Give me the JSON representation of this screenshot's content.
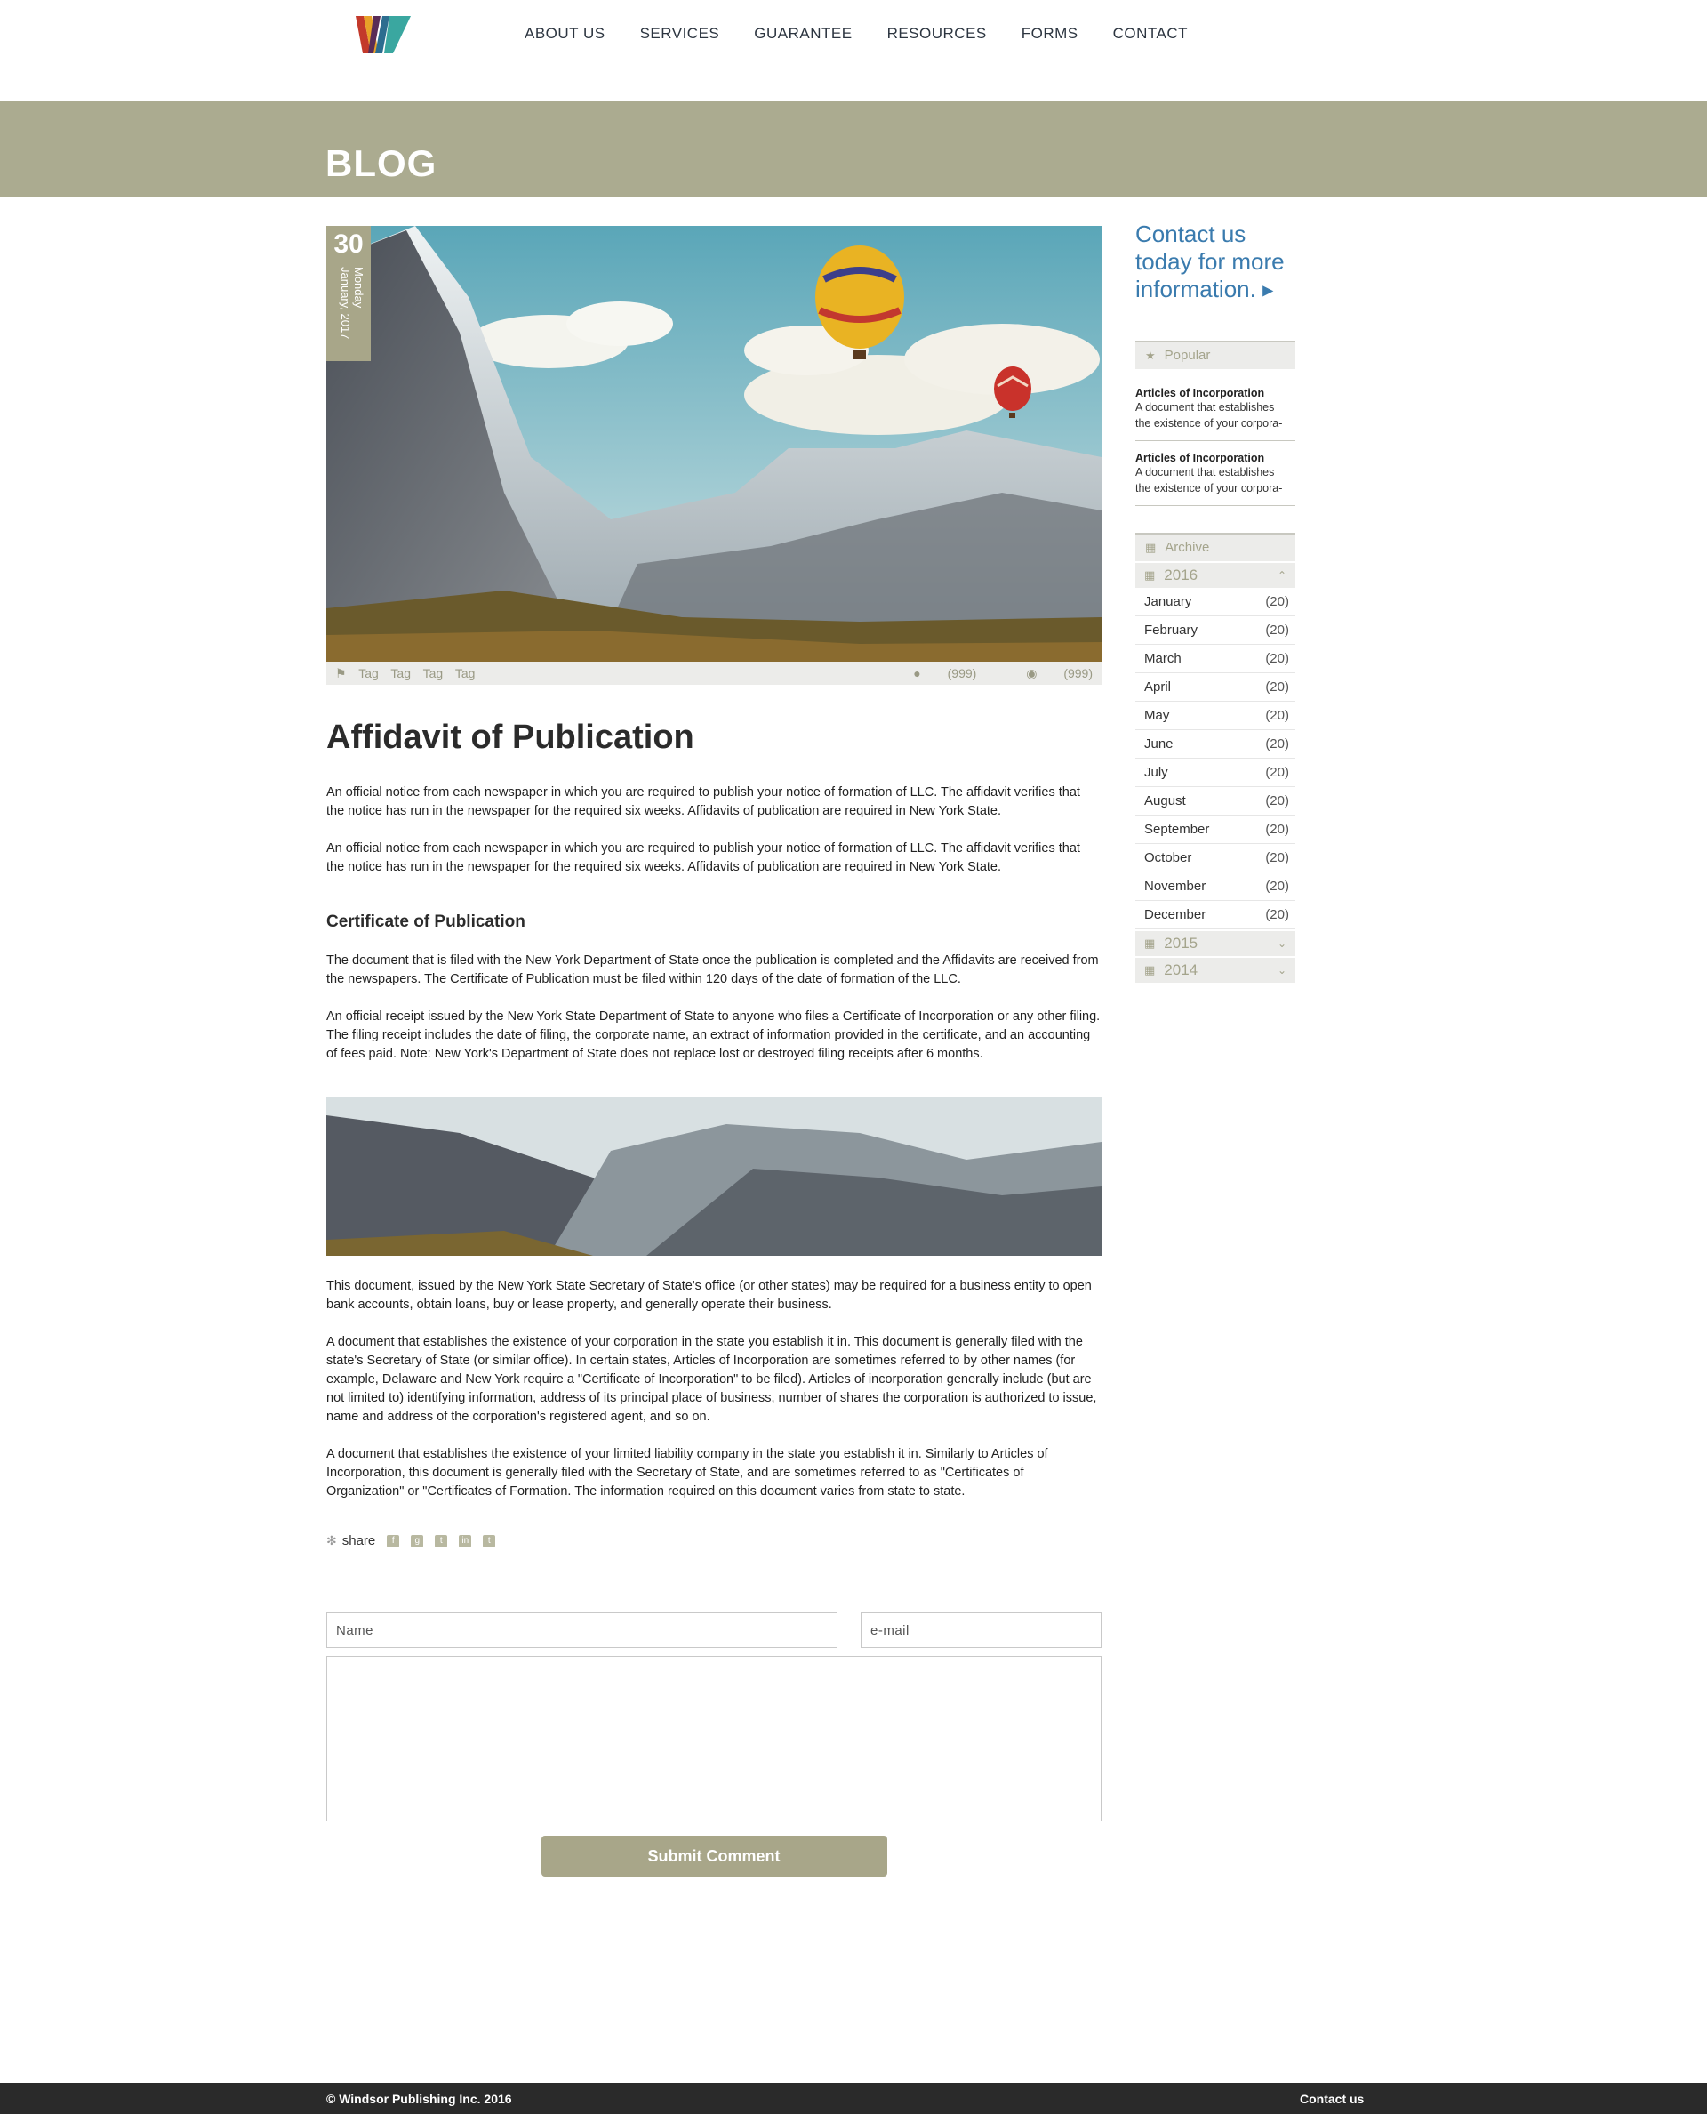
{
  "nav": {
    "logo_label": "W",
    "items": [
      "ABOUT US",
      "SERVICES",
      "GUARANTEE",
      "RESOURCES",
      "FORMS",
      "CONTACT"
    ]
  },
  "banner": {
    "title": "BLOG"
  },
  "post": {
    "date": {
      "day": "30",
      "weekday": "Monday",
      "month_year": "January, 2017"
    },
    "tags": [
      "Tag",
      "Tag",
      "Tag",
      "Tag"
    ],
    "comments": "(999)",
    "views": "(999)",
    "title": "Affidavit of Publication",
    "paragraphs1": [
      "An official notice from each newspaper in which you are required to publish your notice of formation of LLC. The affidavit verifies that the notice has run in the newspaper for the required six weeks. Affidavits of publication are required in New York State.",
      "An official notice from each newspaper in which you are required to publish your notice of formation of LLC. The affidavit verifies that the notice has run in the newspaper for the required six weeks. Affidavits of publication are required in New York State."
    ],
    "subheading": "Certificate of Publication",
    "paragraphs2": [
      "The document that is filed with the New York Department of State once the publication is completed and the Affidavits are received from the newspapers.  The Certificate of Publication must be filed within 120 days of the date of formation of the LLC.",
      "An official receipt issued by the New York State Department of State to anyone who files a Certificate of Incorporation or any other filing. The filing receipt includes the date of filing, the corporate name, an extract of information provided in the certificate, and an accounting of fees paid. Note: New York's Department of State does not replace lost or destroyed filing receipts after 6 months."
    ],
    "paragraphs3": [
      "This document, issued by the New York State Secretary of State's office (or other states) may be required for a business entity to open bank accounts, obtain loans, buy or lease property, and generally operate their business.",
      "A document that establishes the existence of your corporation in the state you establish it in. This document is generally filed with the state's Secretary of State (or similar office). In certain states, Articles of Incorporation are sometimes referred to by other names (for example, Delaware and New York require a \"Certificate of Incorporation\" to be filed). Articles of incorporation generally include (but are not limited to) identifying information, address of its principal place of business, number of shares the corporation is authorized to issue, name and address of the corporation's registered agent, and so on.",
      "A document that establishes the existence of your limited liability company in the state you establish it in. Similarly to Articles of Incorporation, this document is generally filed with the Secretary of State, and are sometimes referred to as \"Certificates of Organization\" or \"Certificates of Formation. The information required on this document varies from state to state."
    ],
    "share_label": "share",
    "social": [
      "facebook-icon",
      "google-plus-icon",
      "twitter-icon",
      "linkedin-icon",
      "tumblr-icon"
    ]
  },
  "comment_form": {
    "name_placeholder": "Name",
    "email_placeholder": "e-mail",
    "submit_label": "Submit Comment"
  },
  "sidebar": {
    "cta_lines": [
      "Contact us",
      "today for more",
      "information."
    ],
    "popular_label": "Popular",
    "popular": [
      {
        "title": "Articles of Incorporation",
        "line1": "A document that establishes",
        "line2": "the existence of your corpora-"
      },
      {
        "title": "Articles of Incorporation",
        "line1": "A document that establishes",
        "line2": "the existence of your corpora-"
      }
    ],
    "archive_label": "Archive",
    "years": [
      "2016",
      "2015",
      "2014"
    ],
    "months": [
      {
        "name": "January",
        "count": "(20)"
      },
      {
        "name": "February",
        "count": "(20)"
      },
      {
        "name": "March",
        "count": "(20)"
      },
      {
        "name": "April",
        "count": "(20)"
      },
      {
        "name": "May",
        "count": "(20)"
      },
      {
        "name": "June",
        "count": "(20)"
      },
      {
        "name": "July",
        "count": "(20)"
      },
      {
        "name": "August",
        "count": "(20)"
      },
      {
        "name": "September",
        "count": "(20)"
      },
      {
        "name": "October",
        "count": "(20)"
      },
      {
        "name": "November",
        "count": "(20)"
      },
      {
        "name": "December",
        "count": "(20)"
      }
    ]
  },
  "footer": {
    "copyright": "© Windsor Publishing Inc. 2016",
    "contact_label": "Contact us"
  },
  "colors": {
    "accent": "#a8a689",
    "banner": "#abab90",
    "link": "#3a7bae",
    "footer": "#2a2a2a"
  }
}
